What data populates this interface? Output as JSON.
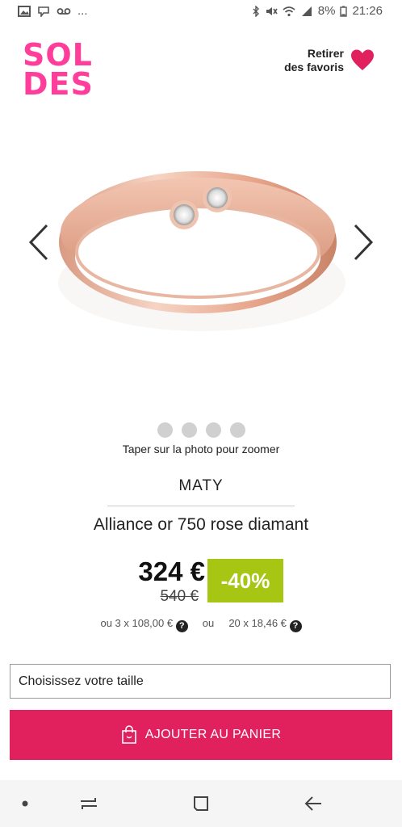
{
  "status": {
    "battery": "8%",
    "time": "21:26",
    "notif_more": "..."
  },
  "logo": {
    "line1": "SOL",
    "line2": "DES"
  },
  "favorites": {
    "line1": "Retirer",
    "line2": "des favoris"
  },
  "carousel": {
    "dot_count": 4,
    "zoom_hint": "Taper sur la photo pour zoomer"
  },
  "product": {
    "brand": "MATY",
    "title": "Alliance or 750 rose diamant",
    "price_now": "324 €",
    "price_old": "540 €",
    "discount": "-40%",
    "installment_1": "ou 3 x 108,00 €",
    "installment_sep": "ou",
    "installment_2": "20 x 18,46 €",
    "help_glyph": "?"
  },
  "size_select": {
    "placeholder": "Choisissez votre taille"
  },
  "cart": {
    "label": "AJOUTER AU PANIER"
  },
  "colors": {
    "logo": "#ff3d9a",
    "heart": "#e0215e",
    "cart": "#e0215e",
    "discount": "#a7c614"
  }
}
